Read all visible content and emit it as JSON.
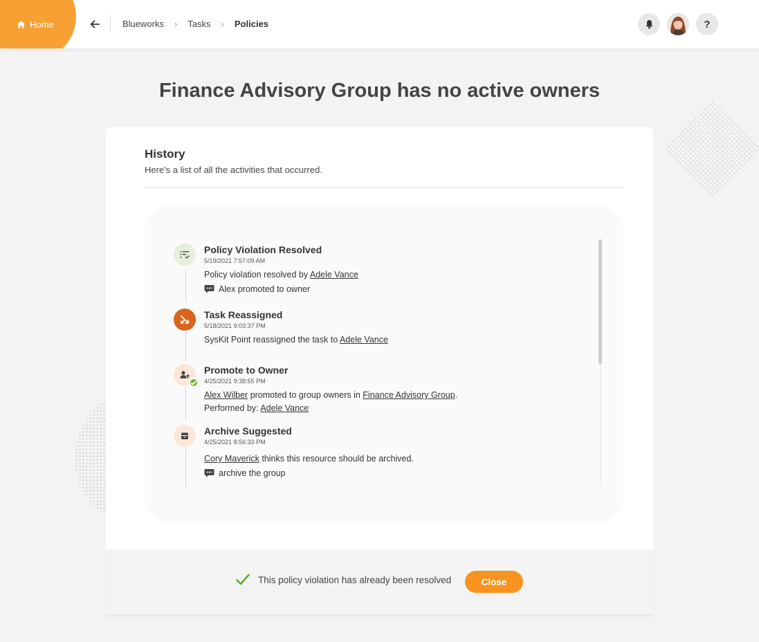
{
  "header": {
    "home_label": "Home",
    "breadcrumb": [
      "Blueworks",
      "Tasks",
      "Policies"
    ],
    "accent_color": "#f7a033"
  },
  "page": {
    "title": "Finance Advisory Group has no active owners"
  },
  "history": {
    "title": "History",
    "subtitle": "Here's a list of all the activities that occurred.",
    "events": [
      {
        "icon": "policy-checklist-icon",
        "title": "Policy Violation Resolved",
        "time": "5/19/2021 7:57:09 AM",
        "line_prefix": "Policy violation resolved by ",
        "line_link": "Adele Vance",
        "comment": "Alex promoted to owner"
      },
      {
        "icon": "reassign-icon",
        "title": "Task Reassigned",
        "time": "5/18/2021 9:03:37 PM",
        "line_prefix": "SysKit Point reassigned the task to ",
        "line_link": "Adele Vance"
      },
      {
        "icon": "promote-user-icon",
        "title": "Promote to Owner",
        "time": "4/25/2021 9:38:55 PM",
        "user_link": "Alex Wilber",
        "line_middle": " promoted to group owners in ",
        "group_link": "Finance Advisory Group",
        "line_end": ".",
        "performed_label": "Performed by: ",
        "performed_link": "Adele Vance"
      },
      {
        "icon": "archive-icon",
        "title": "Archive Suggested",
        "time": "4/25/2021 8:56:33 PM",
        "user_link": "Cory Maverick",
        "line_suffix": " thinks this resource should be archived.",
        "comment": "archive the group"
      }
    ]
  },
  "footer": {
    "resolved_message": "This policy violation has already been resolved",
    "close_label": "Close"
  }
}
